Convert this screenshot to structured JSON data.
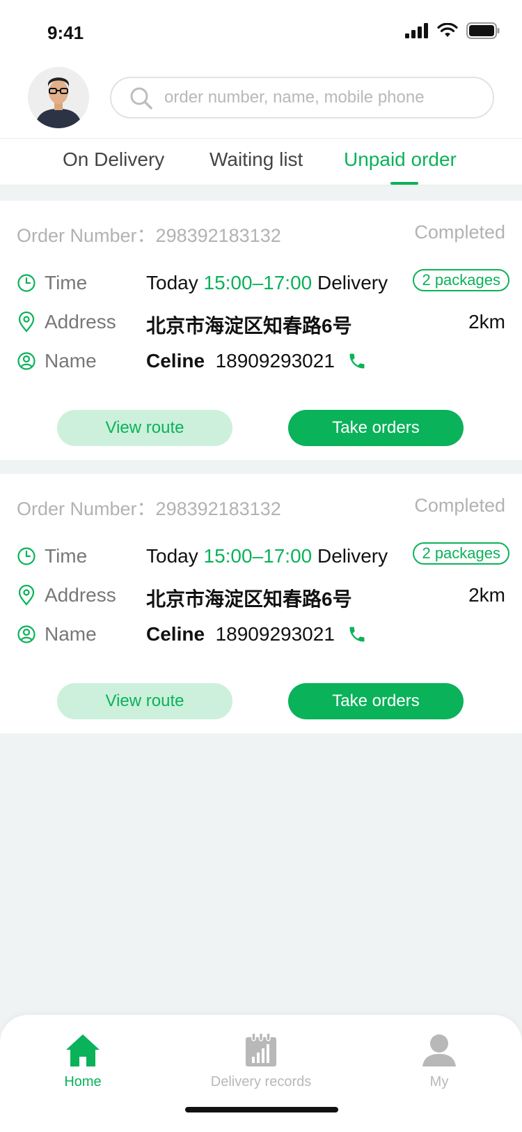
{
  "status_bar": {
    "time": "9:41"
  },
  "search": {
    "placeholder": "order number, name, mobile phone"
  },
  "tabs": [
    {
      "label": "On Delivery",
      "active": false
    },
    {
      "label": "Waiting list",
      "active": false
    },
    {
      "label": "Unpaid order",
      "active": true
    }
  ],
  "orders": [
    {
      "number_label": "Order Number：",
      "number": "298392183132",
      "status": "Completed",
      "time_label": "Time",
      "time_prefix": "Today",
      "time_range": "15:00–17:00",
      "time_suffix": "Delivery",
      "packages": "2 packages",
      "address_label": "Address",
      "address": "北京市海淀区知春路6号",
      "distance": "2km",
      "name_label": "Name",
      "name": "Celine",
      "phone": "18909293021",
      "view_route": "View route",
      "take_orders": "Take orders"
    },
    {
      "number_label": "Order Number：",
      "number": "298392183132",
      "status": "Completed",
      "time_label": "Time",
      "time_prefix": "Today",
      "time_range": "15:00–17:00",
      "time_suffix": "Delivery",
      "packages": "2 packages",
      "address_label": "Address",
      "address": "北京市海淀区知春路6号",
      "distance": "2km",
      "name_label": "Name",
      "name": "Celine",
      "phone": "18909293021",
      "view_route": "View route",
      "take_orders": "Take orders"
    }
  ],
  "bottom_nav": [
    {
      "label": "Home",
      "icon": "home-icon",
      "active": true
    },
    {
      "label": "Delivery records",
      "icon": "calendar-chart-icon",
      "active": false
    },
    {
      "label": "My",
      "icon": "user-icon",
      "active": false
    }
  ],
  "colors": {
    "accent": "#0ab25a",
    "accent_light": "#ccf0dc",
    "background": "#eff3f3"
  }
}
